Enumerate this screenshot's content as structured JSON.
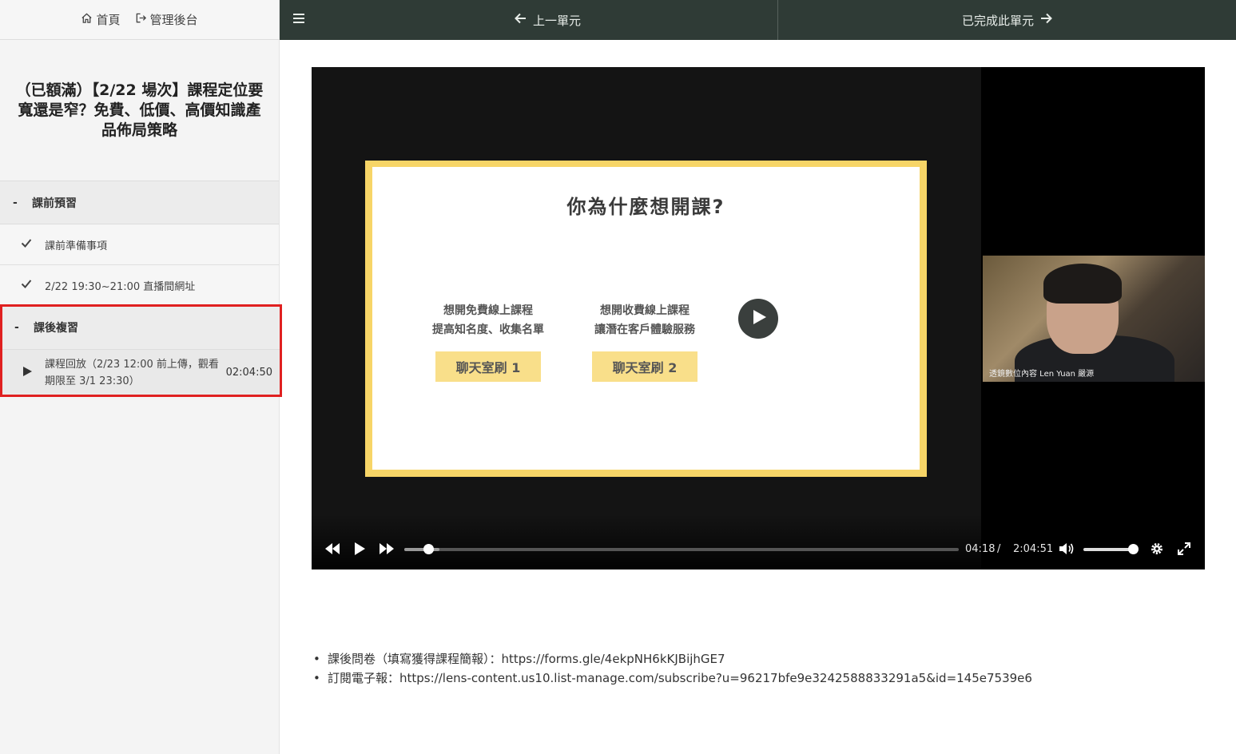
{
  "nav": {
    "home": "首頁",
    "admin": "管理後台"
  },
  "course": {
    "title": "（已額滿）【2/22 場次】課程定位要寬還是窄？免費、低價、高價知識產品佈局策略"
  },
  "sections": [
    {
      "dash": "-",
      "title": "課前預習",
      "lessons": [
        {
          "label": "課前準備事項",
          "icon": "check-icon"
        },
        {
          "label": "2/22 19:30~21:00 直播間網址",
          "icon": "check-icon"
        }
      ]
    },
    {
      "dash": "-",
      "title": "課後複習",
      "lessons": [
        {
          "label": "課程回放（2/23 12:00 前上傳，觀看期限至 3/1 23:30）",
          "duration": "02:04:50",
          "icon": "play-icon"
        }
      ]
    }
  ],
  "topbar": {
    "prev": "上一單元",
    "next": "已完成此單元"
  },
  "video": {
    "slide": {
      "title": "你為什麼想開課?",
      "col1_line1": "想開免費線上課程",
      "col1_line2": "提高知名度、收集名單",
      "col2_line1": "想開收費線上課程",
      "col2_line2": "讓潛在客戶體驗服務",
      "tag1": "聊天室刷 1",
      "tag2": "聊天室刷 2"
    },
    "cam_caption": "透鏡數位內容 Len Yuan 嚴源",
    "current_time": "04:18",
    "time_sep": "/",
    "duration": "2:04:51",
    "progress": 0.035,
    "volume": 1.0
  },
  "links": [
    {
      "label": "課後問卷（填寫獲得課程簡報）：",
      "url": "https://forms.gle/4ekpNH6kKJBijhGE7"
    },
    {
      "label": "訂閱電子報：",
      "url": "https://lens-content.us10.list-manage.com/subscribe?u=96217bfe9e3242588833291a5&id=145e7539e6"
    }
  ],
  "colors": {
    "topbar": "#2f3b36",
    "highlight": "#e02020",
    "slide_border": "#f7d567",
    "slide_tag": "#f9df8a"
  }
}
